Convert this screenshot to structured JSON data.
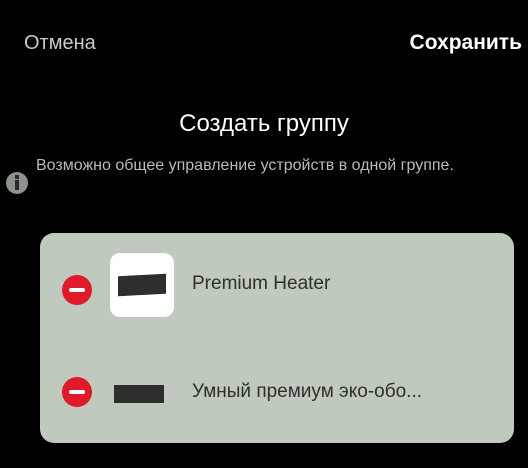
{
  "header": {
    "cancel_label": "Отмена",
    "save_label": "Сохранить"
  },
  "title": "Создать группу",
  "hint": "Возможно общее управление устройств в одной группе.",
  "devices": [
    {
      "name": "Premium Heater"
    },
    {
      "name": "Умный премиум эко-обо..."
    }
  ],
  "colors": {
    "background": "#000000",
    "card": "#bfc9bd",
    "remove": "#e11a2b",
    "primary_text": "#ffffff",
    "secondary_text": "#c7ccc6"
  }
}
